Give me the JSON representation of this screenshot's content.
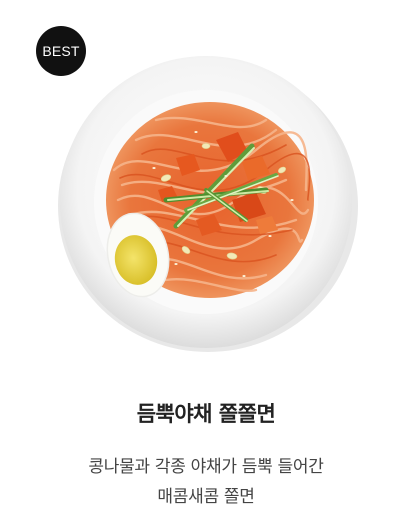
{
  "badge": {
    "label": "BEST"
  },
  "product": {
    "image_icon": "bowl-of-spicy-noodles-illustration",
    "name": "듬뿍야채 쫄쫄면",
    "description_lines": [
      "콩나물과 각종 야채가 듬뿍 들어간",
      "매콤새콤 쫄면"
    ]
  },
  "colors": {
    "badge_bg": "#111111",
    "badge_text": "#ffffff",
    "title": "#222222",
    "description": "#444444"
  }
}
